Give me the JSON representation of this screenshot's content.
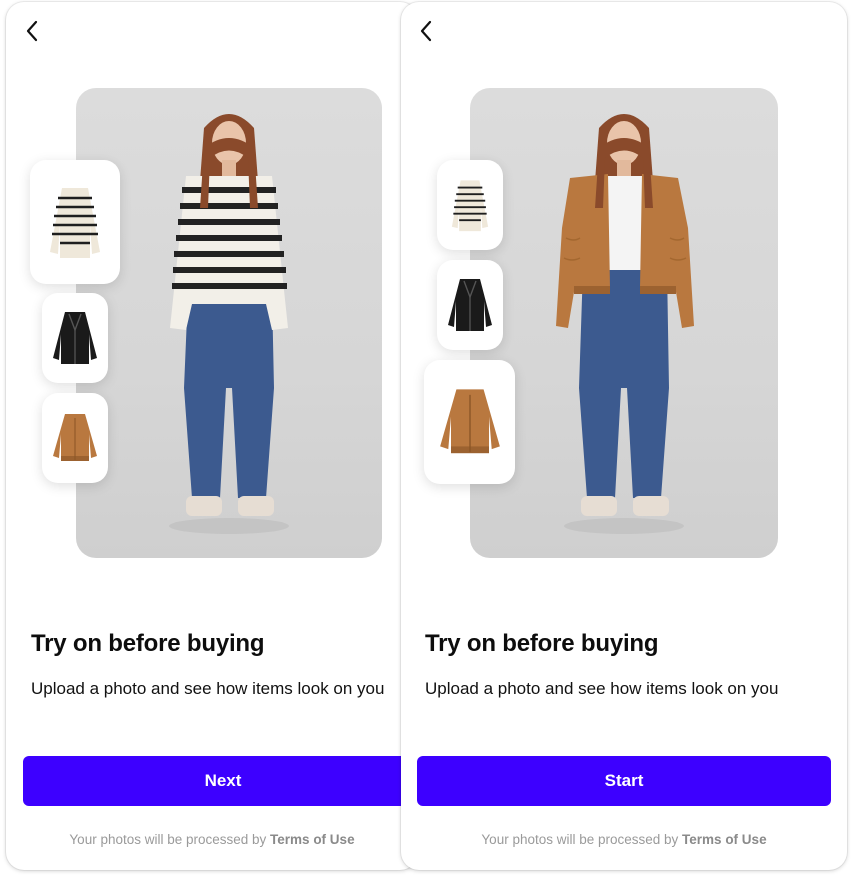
{
  "screens": [
    {
      "title": "Try on before buying",
      "subtitle": "Upload a photo and see how items look on you",
      "cta_label": "Next",
      "footer_prefix": "Your photos will be processed by ",
      "footer_link": "Terms of Use",
      "outfit_top": "striped sweater",
      "thumbnails": [
        "striped-sweater",
        "black-leather-jacket",
        "tan-bomber-jacket"
      ]
    },
    {
      "title": "Try on before buying",
      "subtitle": "Upload a photo and see how items look on you",
      "cta_label": "Start",
      "footer_prefix": "Your photos will be processed by ",
      "footer_link": "Terms of Use",
      "outfit_top": "tan bomber jacket",
      "thumbnails": [
        "striped-sweater",
        "black-leather-jacket",
        "tan-bomber-jacket"
      ]
    }
  ],
  "colors": {
    "accent": "#3d00ff",
    "text": "#0d0d0d",
    "footer": "#9a9a9a",
    "jacket_tan": "#b9783f",
    "denim": "#3c5a8f"
  },
  "icons": {
    "back": "chevron-left-icon"
  }
}
